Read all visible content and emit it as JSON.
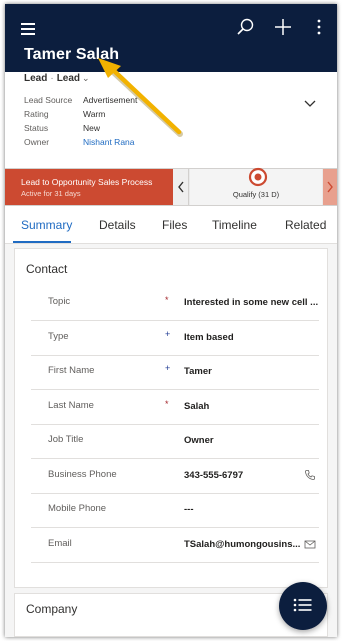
{
  "header": {
    "record_name": "Tamer Salah",
    "entity": "Lead",
    "form": "Lead"
  },
  "summary_fields": [
    {
      "label": "Lead Source",
      "value": "Advertisement"
    },
    {
      "label": "Rating",
      "value": "Warm"
    },
    {
      "label": "Status",
      "value": "New"
    },
    {
      "label": "Owner",
      "value": "Nishant Rana"
    }
  ],
  "process": {
    "name": "Lead to Opportunity Sales Process",
    "active_for": "Active for 31 days",
    "stage_label": "Qualify  (31 D)"
  },
  "tabs": [
    "Summary",
    "Details",
    "Files",
    "Timeline",
    "Related"
  ],
  "contact_section": {
    "title": "Contact",
    "rows": [
      {
        "label": "Topic",
        "marker": "*",
        "value": "Interested in some new cell ..."
      },
      {
        "label": "Type",
        "marker": "+",
        "value": "Item based"
      },
      {
        "label": "First Name",
        "marker": "+",
        "value": "Tamer"
      },
      {
        "label": "Last Name",
        "marker": "*",
        "value": "Salah"
      },
      {
        "label": "Job Title",
        "marker": "",
        "value": "Owner"
      },
      {
        "label": "Business Phone",
        "marker": "",
        "value": "343-555-6797"
      },
      {
        "label": "Mobile Phone",
        "marker": "",
        "value": "---"
      },
      {
        "label": "Email",
        "marker": "",
        "value": "TSalah@humongousins..."
      }
    ]
  },
  "company_section": {
    "title": "Company"
  },
  "colors": {
    "header_bg": "#0c1e3e",
    "process_red": "#cc4a31",
    "accent_blue": "#1f6bc2",
    "annotation_arrow": "#f2b200"
  },
  "icons": [
    "hamburger-icon",
    "search-icon",
    "plus-icon",
    "more-vertical-icon",
    "chevron-down-icon",
    "chevron-left-icon",
    "chevron-right-icon",
    "phone-icon",
    "email-icon",
    "list-icon"
  ]
}
